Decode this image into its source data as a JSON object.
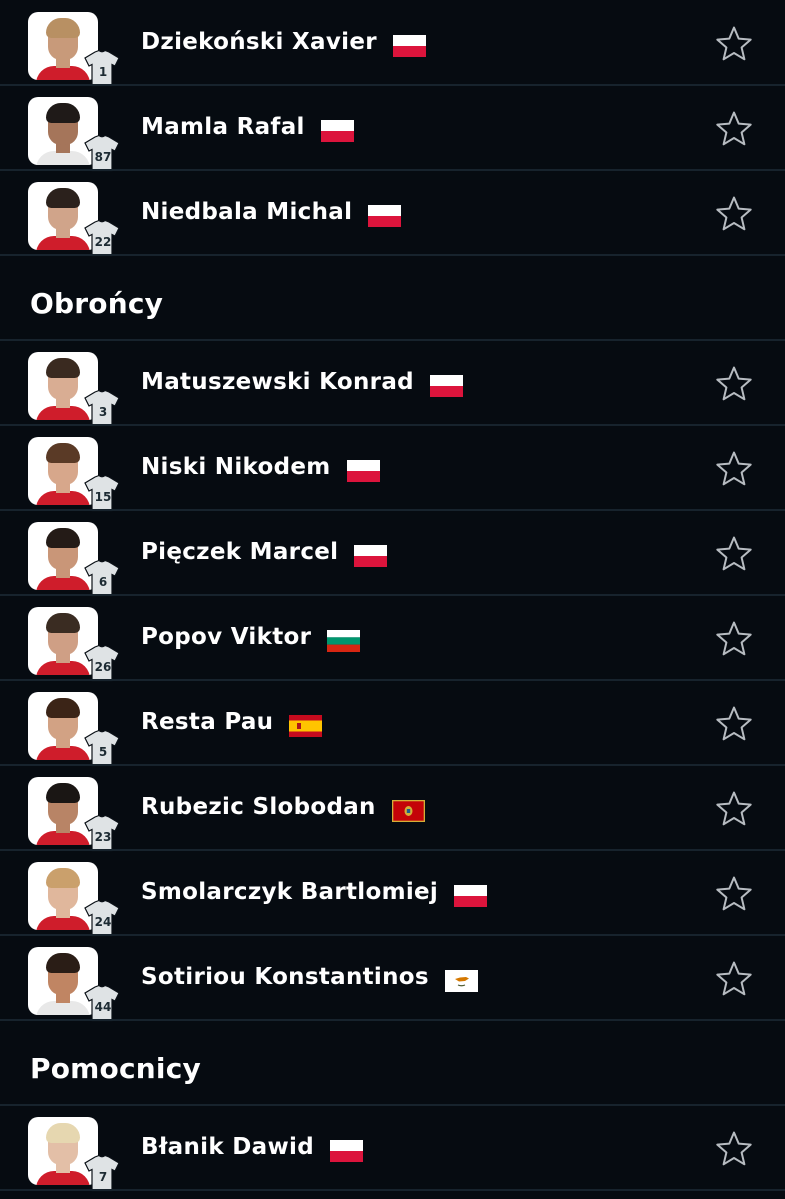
{
  "colors": {
    "background": "#060b11",
    "divider": "#17232d",
    "text": "#ffffff",
    "star_outline": "#b7bcc1",
    "jersey": "#dfe3e5"
  },
  "sections": [
    {
      "title": "",
      "players": [
        {
          "name": "Dziekoński Xavier",
          "number": "1",
          "flag": "poland",
          "icon": "star-outline-icon"
        },
        {
          "name": "Mamla Rafal",
          "number": "87",
          "flag": "poland",
          "icon": "star-outline-icon"
        },
        {
          "name": "Niedbala Michal",
          "number": "22",
          "flag": "poland",
          "icon": "star-outline-icon"
        }
      ]
    },
    {
      "title": "Obrońcy",
      "players": [
        {
          "name": "Matuszewski Konrad",
          "number": "3",
          "flag": "poland",
          "icon": "star-outline-icon"
        },
        {
          "name": "Niski Nikodem",
          "number": "15",
          "flag": "poland",
          "icon": "star-outline-icon"
        },
        {
          "name": "Pięczek Marcel",
          "number": "6",
          "flag": "poland",
          "icon": "star-outline-icon"
        },
        {
          "name": "Popov Viktor",
          "number": "26",
          "flag": "bulgaria",
          "icon": "star-outline-icon"
        },
        {
          "name": "Resta Pau",
          "number": "5",
          "flag": "spain",
          "icon": "star-outline-icon"
        },
        {
          "name": "Rubezic Slobodan",
          "number": "23",
          "flag": "montenegro",
          "icon": "star-outline-icon"
        },
        {
          "name": "Smolarczyk Bartlomiej",
          "number": "24",
          "flag": "poland",
          "icon": "star-outline-icon"
        },
        {
          "name": "Sotiriou Konstantinos",
          "number": "44",
          "flag": "cyprus",
          "icon": "star-outline-icon"
        }
      ]
    },
    {
      "title": "Pomocnicy",
      "players": [
        {
          "name": "Błanik Dawid",
          "number": "7",
          "flag": "poland",
          "icon": "star-outline-icon"
        }
      ]
    }
  ]
}
